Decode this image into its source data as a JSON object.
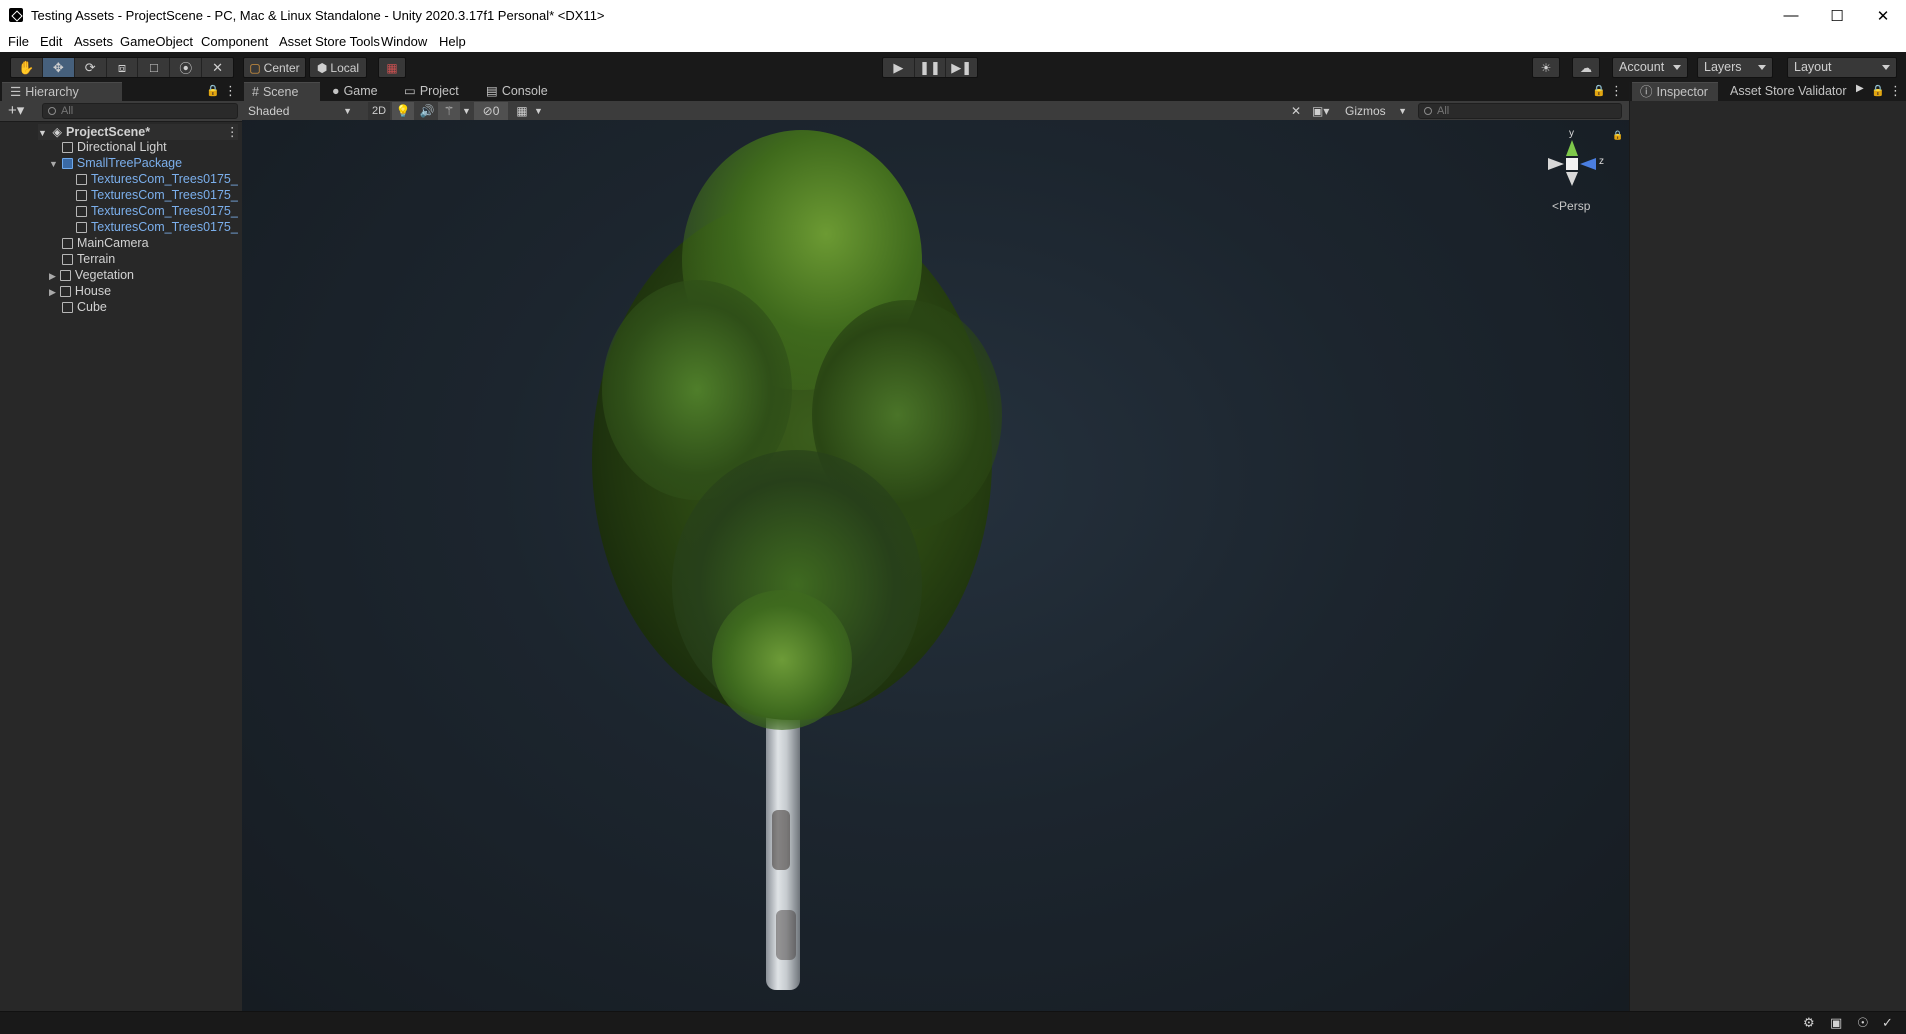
{
  "window": {
    "title": "Testing Assets - ProjectScene - PC, Mac & Linux Standalone - Unity 2020.3.17f1 Personal* <DX11>",
    "controls": [
      "minimize",
      "maximize",
      "close"
    ]
  },
  "menu": {
    "items": [
      "File",
      "Edit",
      "Assets",
      "GameObject",
      "Component",
      "Asset Store Tools",
      "Window",
      "Help"
    ]
  },
  "toolbar": {
    "tools": [
      "hand-tool",
      "move-tool",
      "rotate-tool",
      "scale-tool",
      "rect-tool",
      "transform-tool",
      "custom-tool"
    ],
    "selected_tool": "move-tool",
    "pivot_label": "Center",
    "space_label": "Local",
    "account_label": "Account",
    "layers_label": "Layers",
    "layout_label": "Layout"
  },
  "hierarchy": {
    "tab_label": "Hierarchy",
    "search_placeholder": "All",
    "scene_name": "ProjectScene*",
    "items": [
      {
        "label": "Directional Light",
        "indent": 1,
        "prefab": false
      },
      {
        "label": "SmallTreePackage",
        "indent": 1,
        "prefab": true,
        "expanded": true
      },
      {
        "label": "TexturesCom_Trees0175_",
        "indent": 2,
        "prefab": true
      },
      {
        "label": "TexturesCom_Trees0175_",
        "indent": 2,
        "prefab": true
      },
      {
        "label": "TexturesCom_Trees0175_",
        "indent": 2,
        "prefab": true
      },
      {
        "label": "TexturesCom_Trees0175_",
        "indent": 2,
        "prefab": true
      },
      {
        "label": "MainCamera",
        "indent": 1,
        "prefab": false
      },
      {
        "label": "Terrain",
        "indent": 1,
        "prefab": false
      },
      {
        "label": "Vegetation",
        "indent": 1,
        "prefab": false,
        "collapsed": true
      },
      {
        "label": "House",
        "indent": 1,
        "prefab": false,
        "collapsed": true
      },
      {
        "label": "Cube",
        "indent": 1,
        "prefab": false
      }
    ]
  },
  "scene_tabs": {
    "scene": "Scene",
    "game": "Game",
    "project": "Project",
    "console": "Console"
  },
  "scene_toolbar": {
    "shading_mode": "Shaded",
    "mode_2d": "2D",
    "hidden_count": "0",
    "gizmos_label": "Gizmos",
    "search_placeholder": "All"
  },
  "gizmo": {
    "y_label": "y",
    "z_label": "z",
    "projection_label": "Persp"
  },
  "inspector": {
    "tab_inspector": "Inspector",
    "tab_validator": "Asset Store Validator"
  },
  "colors": {
    "accent_blue": "#7bafec",
    "selected_tool": "#46607c",
    "panel_bg": "#282828",
    "toolbar_bg": "#191919"
  }
}
